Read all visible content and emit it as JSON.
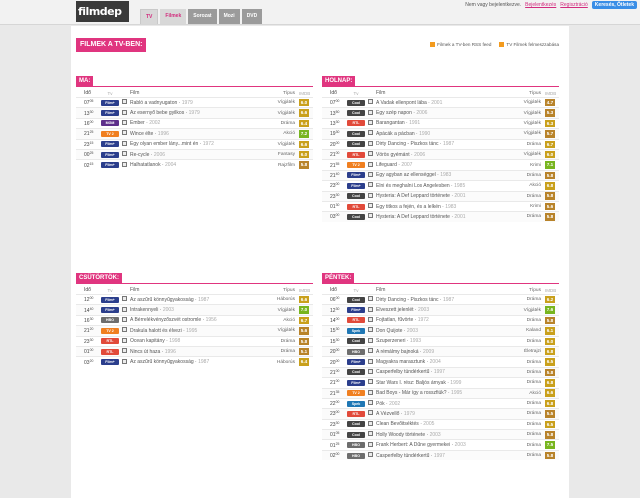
{
  "topbar": {
    "logo": "filmdep",
    "tabs": [
      "TV",
      "Filmek",
      "Sorozat",
      "Mozi",
      "DVD"
    ],
    "user_text": "Nem vagy bejelentkezve.",
    "login": "Bejelentkezés",
    "register": "Regisztráció",
    "search_button": "Keresés, Ötletek"
  },
  "page": {
    "title": "FILMEK A TV-BEN:",
    "rss1": "Filmek a TV-ben RSS feed",
    "rss2": "TV Filmek felmeszzabása"
  },
  "columns": {
    "time": "Idő",
    "ch": "Tv",
    "title": "Film",
    "genre": "Típus",
    "rate": "IMDB"
  },
  "sections": [
    {
      "name": "MA:",
      "rows": [
        {
          "t": "07",
          "m": "05",
          "ch": "film",
          "title": "Rabló a vadnyugaton",
          "yr": "1979",
          "g": "Vígjáték",
          "r": "6.0",
          "c": "o"
        },
        {
          "t": "13",
          "m": "30",
          "ch": "film",
          "title": "Az esernyő bebe gyilkos",
          "yr": "1979",
          "g": "Vígjáték",
          "r": "6.6",
          "c": "o"
        },
        {
          "t": "16",
          "m": "00",
          "ch": "mgm",
          "title": "Ember",
          "yr": "2002",
          "g": "Dráma",
          "r": "6.4",
          "c": "o"
        },
        {
          "t": "21",
          "m": "25",
          "ch": "tv2",
          "title": "Wince élte",
          "yr": "1996",
          "g": "Akció",
          "r": "7.2",
          "c": "g"
        },
        {
          "t": "23",
          "m": "15",
          "ch": "film",
          "title": "Egy olyan ember lány...mint én",
          "yr": "1972",
          "g": "Vígjáték",
          "r": "6.6",
          "c": "o"
        },
        {
          "t": "00",
          "m": "25",
          "ch": "film",
          "title": "Re-cycle",
          "yr": "2006",
          "g": "Fantasy",
          "r": "6.0",
          "c": "o"
        },
        {
          "t": "02",
          "m": "15",
          "ch": "film",
          "title": "Halhatatlanok",
          "yr": "2004",
          "g": "Rajzfilm",
          "r": "5.8",
          "c": "d"
        }
      ]
    },
    {
      "name": "HOLNAP:",
      "rows": [
        {
          "t": "07",
          "m": "00",
          "ch": "cool",
          "title": "A Vadak ellenpont lába",
          "yr": "2001",
          "g": "Vígjáték",
          "r": "4.7",
          "c": "d"
        },
        {
          "t": "13",
          "m": "50",
          "ch": "cool",
          "title": "Egy szép napon",
          "yr": "2006",
          "g": "Vígjáték",
          "r": "5.3",
          "c": "d"
        },
        {
          "t": "13",
          "m": "30",
          "ch": "red",
          "title": "Barangantan",
          "yr": "1991",
          "g": "Vígjáték",
          "r": "6.3",
          "c": "o"
        },
        {
          "t": "19",
          "m": "30",
          "ch": "cool",
          "title": "Apácák a pácban",
          "yr": "1990",
          "g": "Vígjáték",
          "r": "5.7",
          "c": "d"
        },
        {
          "t": "20",
          "m": "00",
          "ch": "cool",
          "title": "Dirty Dancing - Piszkos tánc",
          "yr": "1987",
          "g": "Dráma",
          "r": "6.7",
          "c": "o"
        },
        {
          "t": "21",
          "m": "00",
          "ch": "red",
          "title": "Vörös gyémánt",
          "yr": "2006",
          "g": "Vígjáték",
          "r": "6.0",
          "c": "o"
        },
        {
          "t": "21",
          "m": "55",
          "ch": "tv2",
          "title": "Lifeguard",
          "yr": "2007",
          "g": "Krimi",
          "r": "7.1",
          "c": "g"
        },
        {
          "t": "21",
          "m": "40",
          "ch": "film",
          "title": "Egy agyban az ellenséggel",
          "yr": "1983",
          "g": "Dráma",
          "r": "5.8",
          "c": "d"
        },
        {
          "t": "23",
          "m": "00",
          "ch": "film",
          "title": "Élni és meghalni Los Angelesben",
          "yr": "1985",
          "g": "Akció",
          "r": "6.8",
          "c": "o"
        },
        {
          "t": "23",
          "m": "30",
          "ch": "cool",
          "title": "Hysteria: A Def Leppard története",
          "yr": "2001",
          "g": "Dráma",
          "r": "5.8",
          "c": "d"
        },
        {
          "t": "01",
          "m": "30",
          "ch": "red",
          "title": "Egy titkos a fején, és a lelkén",
          "yr": "1983",
          "g": "Krimi",
          "r": "5.6",
          "c": "d"
        },
        {
          "t": "03",
          "m": "00",
          "ch": "cool",
          "title": "Hysteria: A Def Leppard története",
          "yr": "2001",
          "g": "Dráma",
          "r": "5.8",
          "c": "d"
        }
      ]
    },
    {
      "name": "CSÜTÖRTÖK:",
      "rows": [
        {
          "t": "12",
          "m": "00",
          "ch": "film",
          "title": "Az aszűrű könnyűgyakosság",
          "yr": "1987",
          "g": "Háborús",
          "r": "6.6",
          "c": "o"
        },
        {
          "t": "14",
          "m": "40",
          "ch": "film",
          "title": "Intrakennyeli",
          "yr": "2003",
          "g": "Vígjáték",
          "r": "7.0",
          "c": "g"
        },
        {
          "t": "16",
          "m": "30",
          "ch": "hbo",
          "title": "A Bérrelékvényzőszvét ostromle",
          "yr": "1956",
          "g": "Akció",
          "r": "6.7",
          "c": "o"
        },
        {
          "t": "21",
          "m": "20",
          "ch": "tv2",
          "title": "Drakula halott és élvezi",
          "yr": "1995",
          "g": "Vígjáték",
          "r": "5.6",
          "c": "d"
        },
        {
          "t": "23",
          "m": "30",
          "ch": "red",
          "title": "Ocean kapitány",
          "yr": "1998",
          "g": "Dráma",
          "r": "5.8",
          "c": "d"
        },
        {
          "t": "01",
          "m": "00",
          "ch": "red",
          "title": "Nincs út haza",
          "yr": "1996",
          "g": "Dráma",
          "r": "5.1",
          "c": "d"
        },
        {
          "t": "03",
          "m": "20",
          "ch": "film",
          "title": "Az aszűrű könnyűgyakosság",
          "yr": "1987",
          "g": "Háborús",
          "r": "6.4",
          "c": "o"
        }
      ]
    },
    {
      "name": "PÉNTEK:",
      "rows": [
        {
          "t": "06",
          "m": "00",
          "ch": "cool",
          "title": "Dirty Dancing - Piszkos tánc",
          "yr": "1987",
          "g": "Dráma",
          "r": "6.2",
          "c": "o"
        },
        {
          "t": "12",
          "m": "30",
          "ch": "film",
          "title": "Elveszett jelenlét",
          "yr": "2003",
          "g": "Vígjáték",
          "r": "7.6",
          "c": "g"
        },
        {
          "t": "14",
          "m": "00",
          "ch": "red",
          "title": "Fojtatlan, fűvörte",
          "yr": "1972",
          "g": "Dráma",
          "r": "5.8",
          "c": "d"
        },
        {
          "t": "15",
          "m": "30",
          "ch": "blue",
          "title": "Don Quijote",
          "yr": "2003",
          "g": "Kaland",
          "r": "6.1",
          "c": "o"
        },
        {
          "t": "15",
          "m": "30",
          "ch": "cool",
          "title": "Szuperzeneri",
          "yr": "1993",
          "g": "Dráma",
          "r": "6.0",
          "c": "o"
        },
        {
          "t": "20",
          "m": "00",
          "ch": "hbo",
          "title": "A rémálmy bajnoká",
          "yr": "2009",
          "g": "Életrajzi",
          "r": "6.8",
          "c": "o"
        },
        {
          "t": "20",
          "m": "00",
          "ch": "film",
          "title": "Magyakra marasztunk",
          "yr": "2004",
          "g": "Dráma",
          "r": "6.5",
          "c": "o"
        },
        {
          "t": "21",
          "m": "00",
          "ch": "cool",
          "title": "Casperfelby tündérkertű",
          "yr": "1997",
          "g": "Dráma",
          "r": "5.8",
          "c": "d"
        },
        {
          "t": "21",
          "m": "00",
          "ch": "film",
          "title": "Star Wars I. rész: Baljós árnyak",
          "yr": "1999",
          "g": "Dráma",
          "r": "6.8",
          "c": "o"
        },
        {
          "t": "21",
          "m": "35",
          "ch": "tv2",
          "title": "Bad Boys - Már így a rosszfiúk?",
          "yr": "1995",
          "g": "Akció",
          "r": "6.6",
          "c": "o"
        },
        {
          "t": "22",
          "m": "00",
          "ch": "blue",
          "title": "Pók",
          "yr": "2002",
          "g": "Dráma",
          "r": "6.8",
          "c": "o"
        },
        {
          "t": "23",
          "m": "00",
          "ch": "red",
          "title": "A Vézvellő",
          "yr": "1979",
          "g": "Dráma",
          "r": "5.5",
          "c": "d"
        },
        {
          "t": "23",
          "m": "30",
          "ch": "cool",
          "title": "Clean Bevőitséktés",
          "yr": "2005",
          "g": "Dráma",
          "r": "6.5",
          "c": "o"
        },
        {
          "t": "01",
          "m": "05",
          "ch": "cool",
          "title": "Holly Woody története",
          "yr": "2003",
          "g": "Dráma",
          "r": "5.8",
          "c": "d"
        },
        {
          "t": "01",
          "m": "25",
          "ch": "hbo",
          "title": "Frank Herbert: A Dűne gyermekei",
          "yr": "2003",
          "g": "Dráma",
          "r": "7.5",
          "c": "g"
        },
        {
          "t": "02",
          "m": "00",
          "ch": "hbo",
          "title": "Casperfelby tündérkertű",
          "yr": "1997",
          "g": "Dráma",
          "r": "5.8",
          "c": "d"
        }
      ]
    }
  ],
  "channel_labels": {
    "film": "Film+",
    "mgm": "MGM",
    "tv2": "TV 2",
    "hbo": "HBO",
    "cool": "Cool",
    "red": "RTL",
    "blue": "Spek"
  }
}
